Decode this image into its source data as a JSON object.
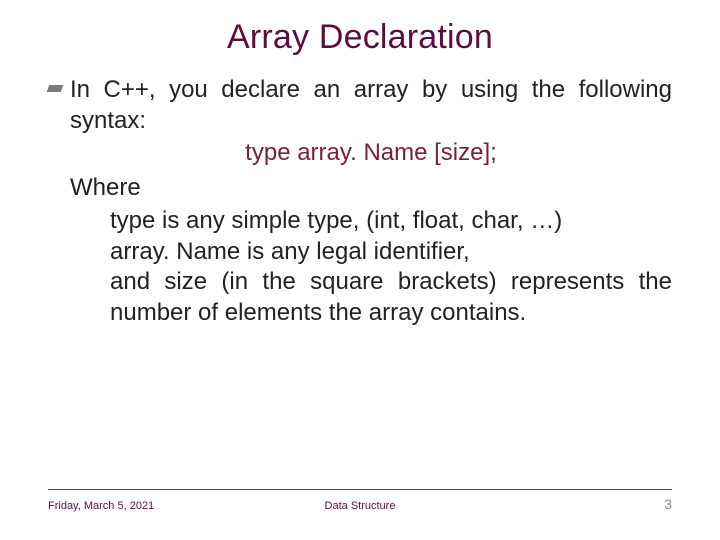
{
  "title": "Array Declaration",
  "body": {
    "intro": "In C++, you declare an array by using the following syntax:",
    "syntax": "type array. Name [size];",
    "where": "Where",
    "line1": "type is any simple type, (int, float, char, …)",
    "line2": "array. Name is any legal identifier,",
    "line3": "and size (in the square brackets) represents the number of elements the array contains."
  },
  "footer": {
    "date": "Friday, March 5, 2021",
    "center": "Data Structure",
    "page": "3"
  }
}
